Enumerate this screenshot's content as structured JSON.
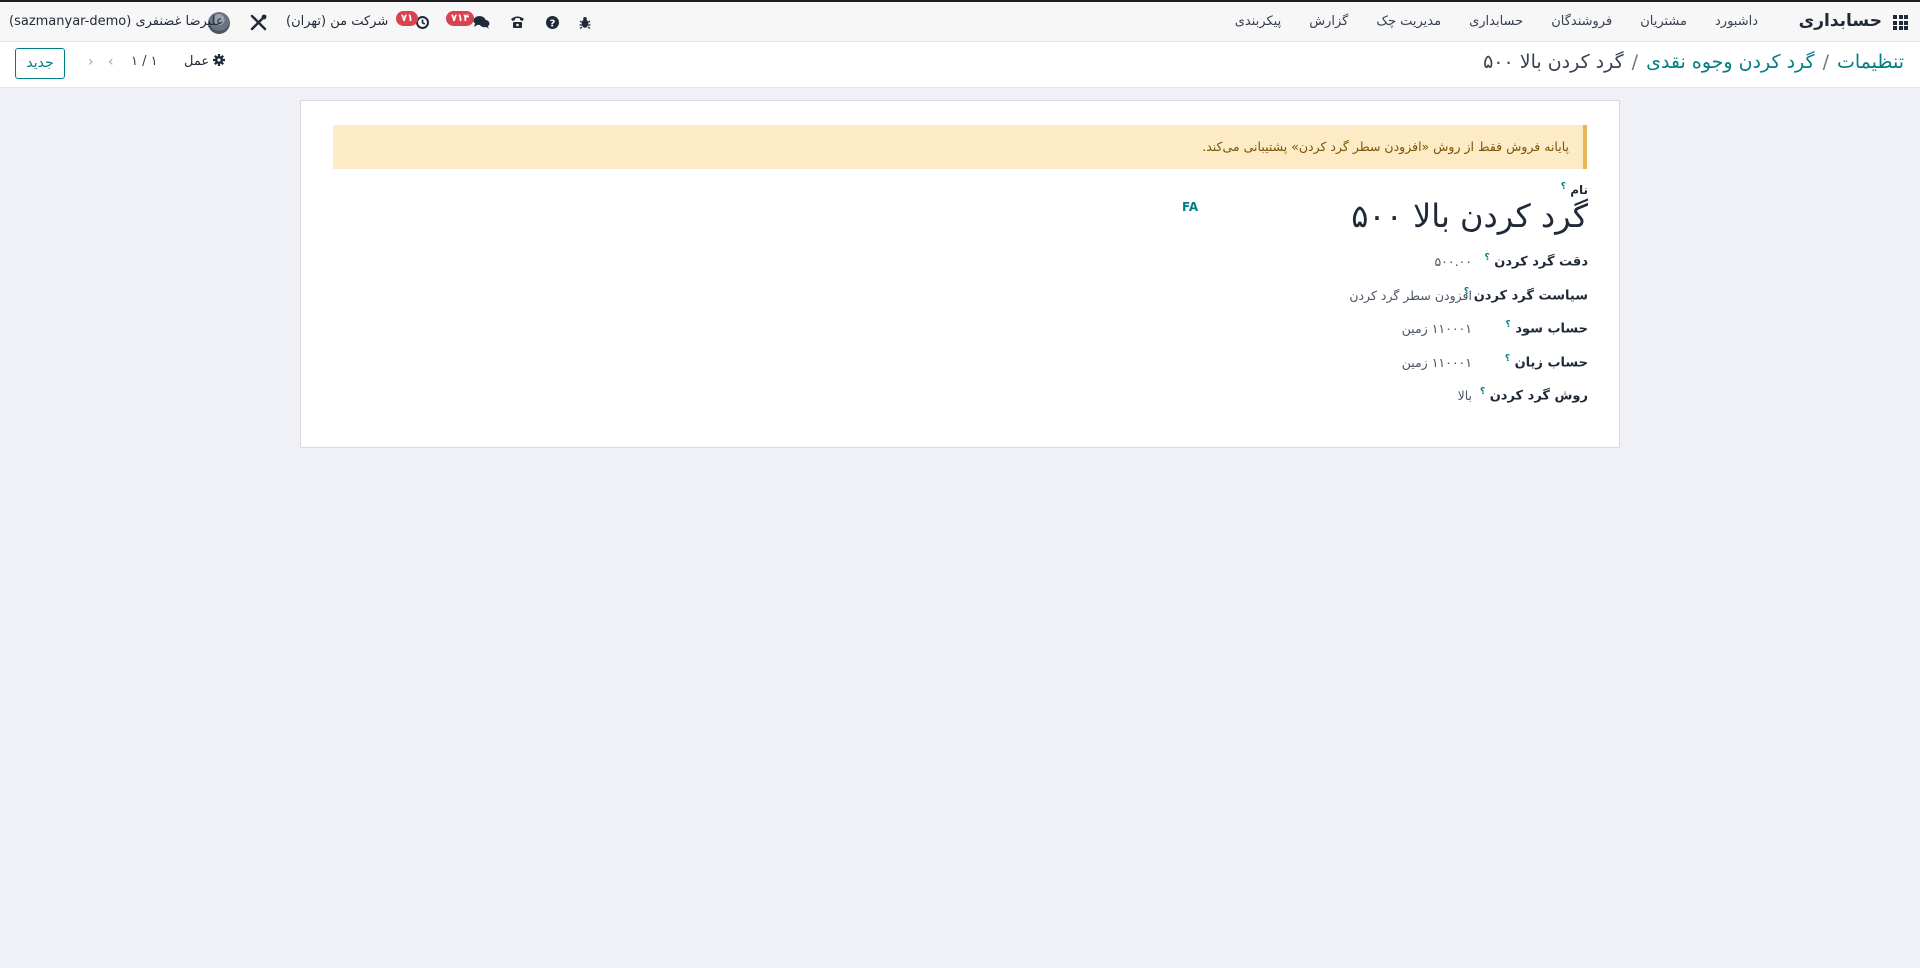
{
  "navbar": {
    "app_title": "حسابداری",
    "menu": [
      "داشبورد",
      "مشتریان",
      "فروشندگان",
      "حسابداری",
      "مدیریت چک",
      "گزارش",
      "پیکربندی"
    ],
    "activity_badge": "۷۱",
    "messages_badge": "۷۱۴",
    "company": "شرکت من (تهران)",
    "user": "علیرضا غضنفری (sazmanyar-demo)"
  },
  "control": {
    "breadcrumb": [
      "تنظیمات",
      "گرد کردن وجوه نقدی",
      "گرد کردن بالا ۵۰۰"
    ],
    "new_button": "جدید",
    "pager": "۱ / ۱",
    "action": "عمل"
  },
  "form": {
    "alert": "پایانه فروش فقط از روش «افزودن سطر گرد کردن» پشتیبانی می‌کند.",
    "name_label": "نام",
    "name_value": "گرد کردن بالا ۵۰۰",
    "lang": "FA",
    "tooltip_mark": "؟",
    "fields": [
      {
        "label": "دقت گرد کردن",
        "value": "۵۰۰.۰۰"
      },
      {
        "label": "سیاست گرد کردن",
        "value": "افزودن سطر گرد کردن"
      },
      {
        "label": "حساب سود",
        "value": "۱۱۰۰۰۱ زمین"
      },
      {
        "label": "حساب زیان",
        "value": "۱۱۰۰۰۱ زمین"
      },
      {
        "label": "روش گرد کردن",
        "value": "بالا"
      }
    ]
  }
}
